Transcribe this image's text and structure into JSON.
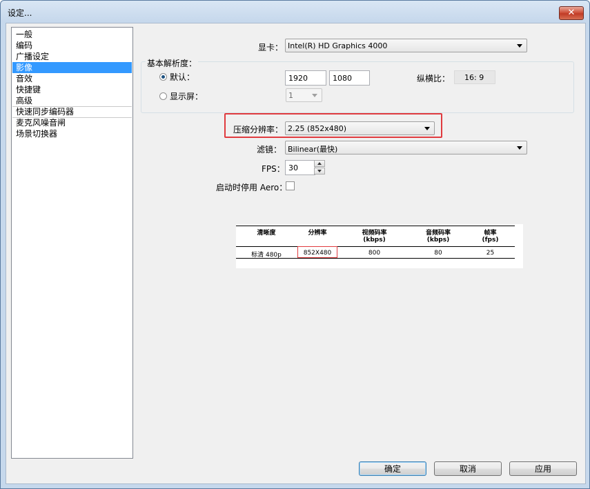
{
  "window": {
    "title": "设定...",
    "close_glyph": "✕"
  },
  "sidebar": {
    "items": [
      {
        "label": "一般"
      },
      {
        "label": "编码"
      },
      {
        "label": "广播设定"
      },
      {
        "label": "影像",
        "selected": true
      },
      {
        "label": "音效"
      },
      {
        "label": "快捷键"
      },
      {
        "label": "高级"
      },
      {
        "label": "快速同步编码器"
      },
      {
        "label": "麦克风噪音闸"
      },
      {
        "label": "场景切换器"
      }
    ]
  },
  "video": {
    "gpu_label": "显卡：",
    "gpu_value": "Intel(R) HD Graphics 4000",
    "base_res_label": "基本解析度：",
    "default_label": "默认：",
    "default_selected": true,
    "width": "1920",
    "height": "1080",
    "aspect_label": "纵横比：",
    "aspect_value": "16: 9",
    "monitor_label": "显示屏：",
    "monitor_value": "1",
    "downscale_label": "压缩分辨率：",
    "downscale_value": "2.25  (852x480)",
    "filter_label": "滤镜：",
    "filter_value": "Bilinear(最快)",
    "fps_label": "FPS：",
    "fps_value": "30",
    "aero_label": "启动时停用 Aero：",
    "aero_checked": false
  },
  "ref_table": {
    "headers": [
      {
        "line1": "清晰度",
        "line2": ""
      },
      {
        "line1": "分辨率",
        "line2": ""
      },
      {
        "line1": "视频码率",
        "line2": "(kbps)"
      },
      {
        "line1": "音频码率",
        "line2": "(kbps)"
      },
      {
        "line1": "帧率",
        "line2": "(fps)"
      }
    ],
    "row": [
      "标清 480p",
      "852X480",
      "800",
      "80",
      "25"
    ]
  },
  "buttons": {
    "ok": "确定",
    "cancel": "取消",
    "apply": "应用"
  },
  "colors": {
    "selection": "#3399ff",
    "highlight_red": "#e03a3e",
    "close_red": "#c13b26"
  },
  "icons": {
    "dropdown": "chevron-down-icon",
    "spin_up": "spin-up-icon",
    "spin_down": "spin-down-icon"
  }
}
